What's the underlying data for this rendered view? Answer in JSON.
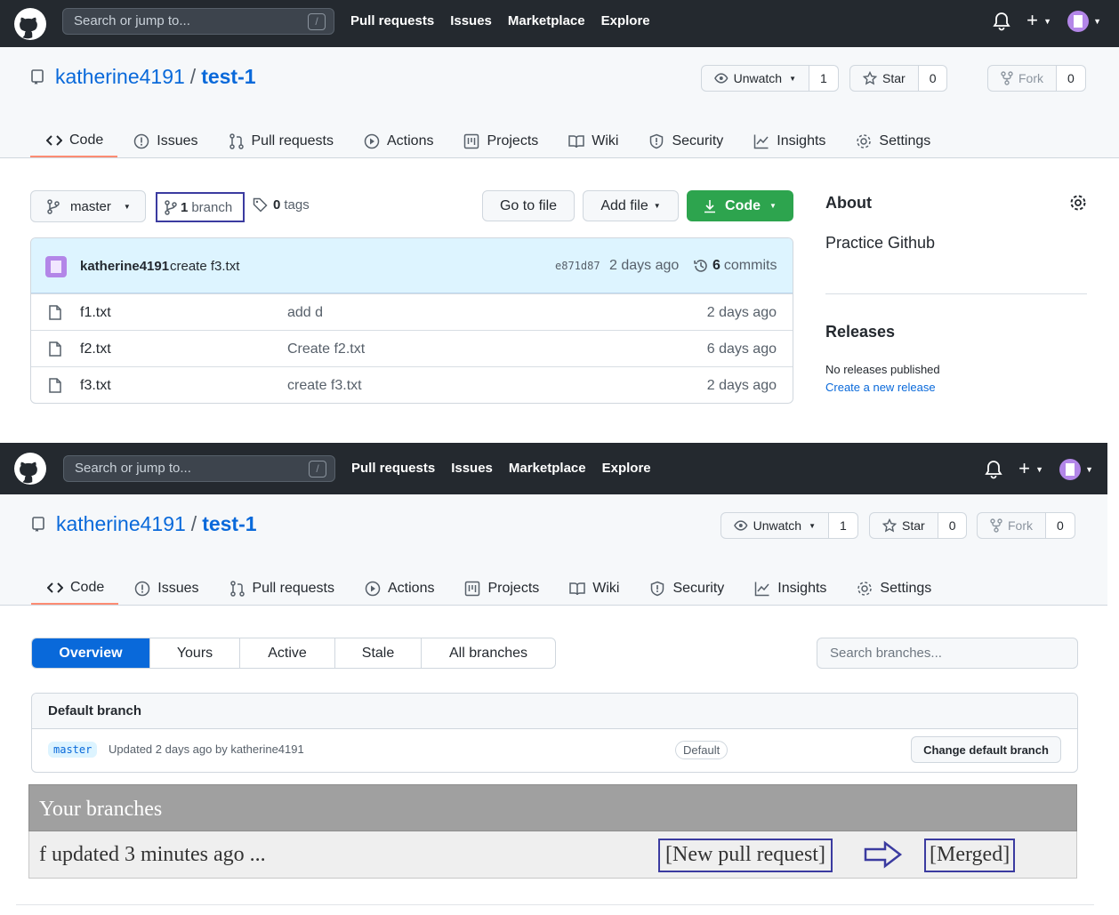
{
  "header": {
    "search_placeholder": "Search or jump to...",
    "slash_key": "/",
    "nav": [
      "Pull requests",
      "Issues",
      "Marketplace",
      "Explore"
    ],
    "plus": "+"
  },
  "repo": {
    "owner": "katherine4191",
    "separator": "/",
    "name": "test-1",
    "unwatch_label": "Unwatch",
    "watch_count": "1",
    "star_label": "Star",
    "star_count": "0",
    "fork_label": "Fork",
    "fork_count": "0"
  },
  "tabs": [
    "Code",
    "Issues",
    "Pull requests",
    "Actions",
    "Projects",
    "Wiki",
    "Security",
    "Insights",
    "Settings"
  ],
  "code_view": {
    "branch_name": "master",
    "branch_count": "1",
    "branch_word": "branch",
    "tag_count": "0",
    "tag_word": "tags",
    "go_to_file": "Go to file",
    "add_file": "Add file",
    "code_button": "Code",
    "latest_commit": {
      "user": "katherine4191",
      "message": "create f3.txt",
      "sha": "e871d87",
      "age": "2 days ago",
      "commit_count": "6",
      "commit_word": "commits"
    },
    "files": [
      {
        "name": "f1.txt",
        "message": "add d",
        "age": "2 days ago"
      },
      {
        "name": "f2.txt",
        "message": "Create f2.txt",
        "age": "6 days ago"
      },
      {
        "name": "f3.txt",
        "message": "create f3.txt",
        "age": "2 days ago"
      }
    ]
  },
  "sidebar": {
    "about_title": "About",
    "description": "Practice Github",
    "releases_title": "Releases",
    "no_releases": "No releases published",
    "create_release": "Create a new release"
  },
  "branches_view": {
    "subnav": [
      "Overview",
      "Yours",
      "Active",
      "Stale",
      "All branches"
    ],
    "search_placeholder": "Search branches...",
    "default_heading": "Default branch",
    "default_branch": "master",
    "default_updated": "Updated 2 days ago by katherine4191",
    "default_badge": "Default",
    "change_default": "Change default branch",
    "your_branches_heading": "Your branches",
    "your_branch_row": "f updated 3 minutes ago ...",
    "new_pr_label": "[New pull request]",
    "merged_label": "[Merged]"
  },
  "colors": {
    "header_bg": "#24292f",
    "accent_blue": "#0969da",
    "code_green": "#2da44e",
    "selected_tab_underline": "#fd8c73",
    "annotation_box": "#3b3ba0"
  },
  "icons": [
    "github-logo-icon",
    "bell-icon",
    "plus-icon",
    "repo-icon",
    "eye-icon",
    "star-icon",
    "fork-icon",
    "code-icon",
    "issue-icon",
    "pull-request-icon",
    "play-icon",
    "project-icon",
    "book-icon",
    "shield-icon",
    "graph-icon",
    "gear-icon",
    "branch-icon",
    "tag-icon",
    "download-icon",
    "history-icon",
    "file-icon",
    "arrow-right-icon"
  ]
}
